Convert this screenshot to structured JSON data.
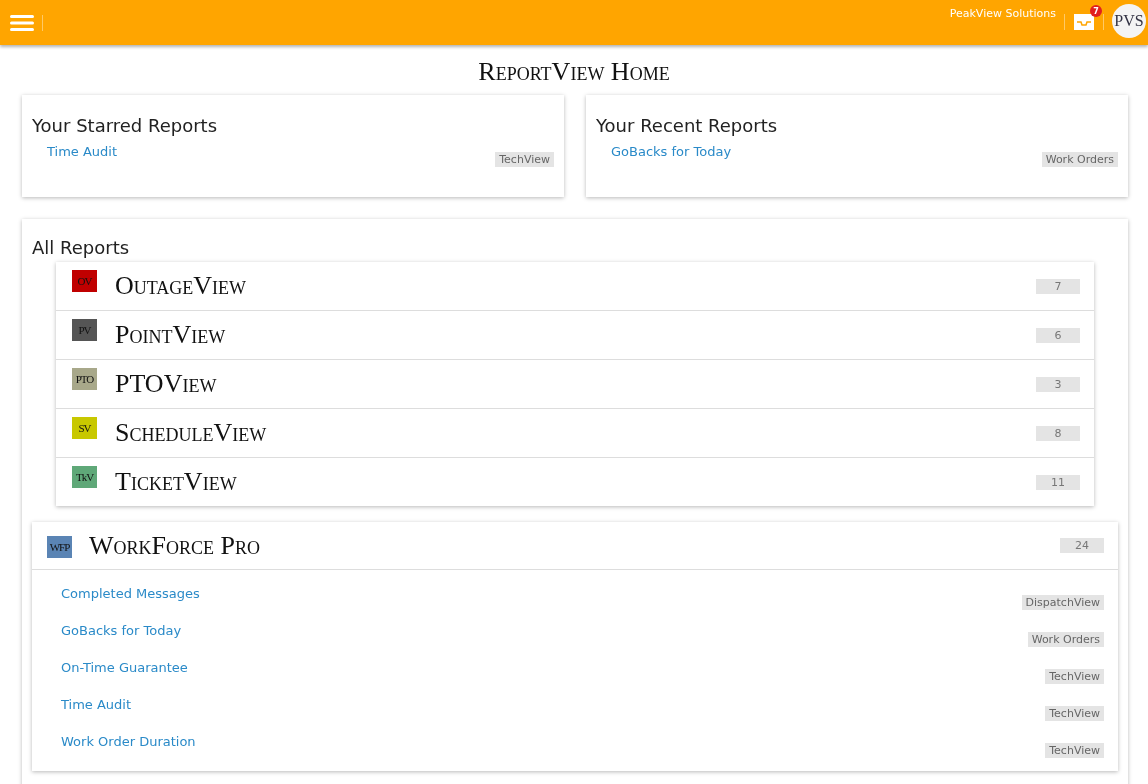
{
  "header": {
    "company": "PeakView Solutions",
    "notification_count": "7",
    "avatar_text": "PVS"
  },
  "page_title": "ReportView Home",
  "starred": {
    "title": "Your Starred Reports",
    "items": [
      {
        "label": "Time Audit",
        "tag": "TechView"
      }
    ]
  },
  "recent": {
    "title": "Your Recent Reports",
    "items": [
      {
        "label": "GoBacks for Today",
        "tag": "Work Orders"
      }
    ]
  },
  "all_reports": {
    "title": "All Reports",
    "products": [
      {
        "logo": "OV",
        "name": "OutageView",
        "count": "7",
        "color": "#c00000"
      },
      {
        "logo": "PV",
        "name": "PointView",
        "count": "6",
        "color": "#555555"
      },
      {
        "logo": "PTO",
        "name": "PTOView",
        "count": "3",
        "color": "#a8a88a"
      },
      {
        "logo": "SV",
        "name": "ScheduleView",
        "count": "8",
        "color": "#c8c800"
      },
      {
        "logo": "TkV",
        "name": "TicketView",
        "count": "11",
        "color": "#5fa878"
      }
    ]
  },
  "workforce": {
    "logo": "WFP",
    "name": "WorkForce Pro",
    "count": "24",
    "color": "#5a84b4",
    "expanded": true,
    "reports": [
      {
        "label": "Completed Messages",
        "tag": "DispatchView"
      },
      {
        "label": "GoBacks for Today",
        "tag": "Work Orders"
      },
      {
        "label": "On-Time Guarantee",
        "tag": "TechView"
      },
      {
        "label": "Time Audit",
        "tag": "TechView"
      },
      {
        "label": "Work Order Duration",
        "tag": "TechView"
      }
    ]
  }
}
